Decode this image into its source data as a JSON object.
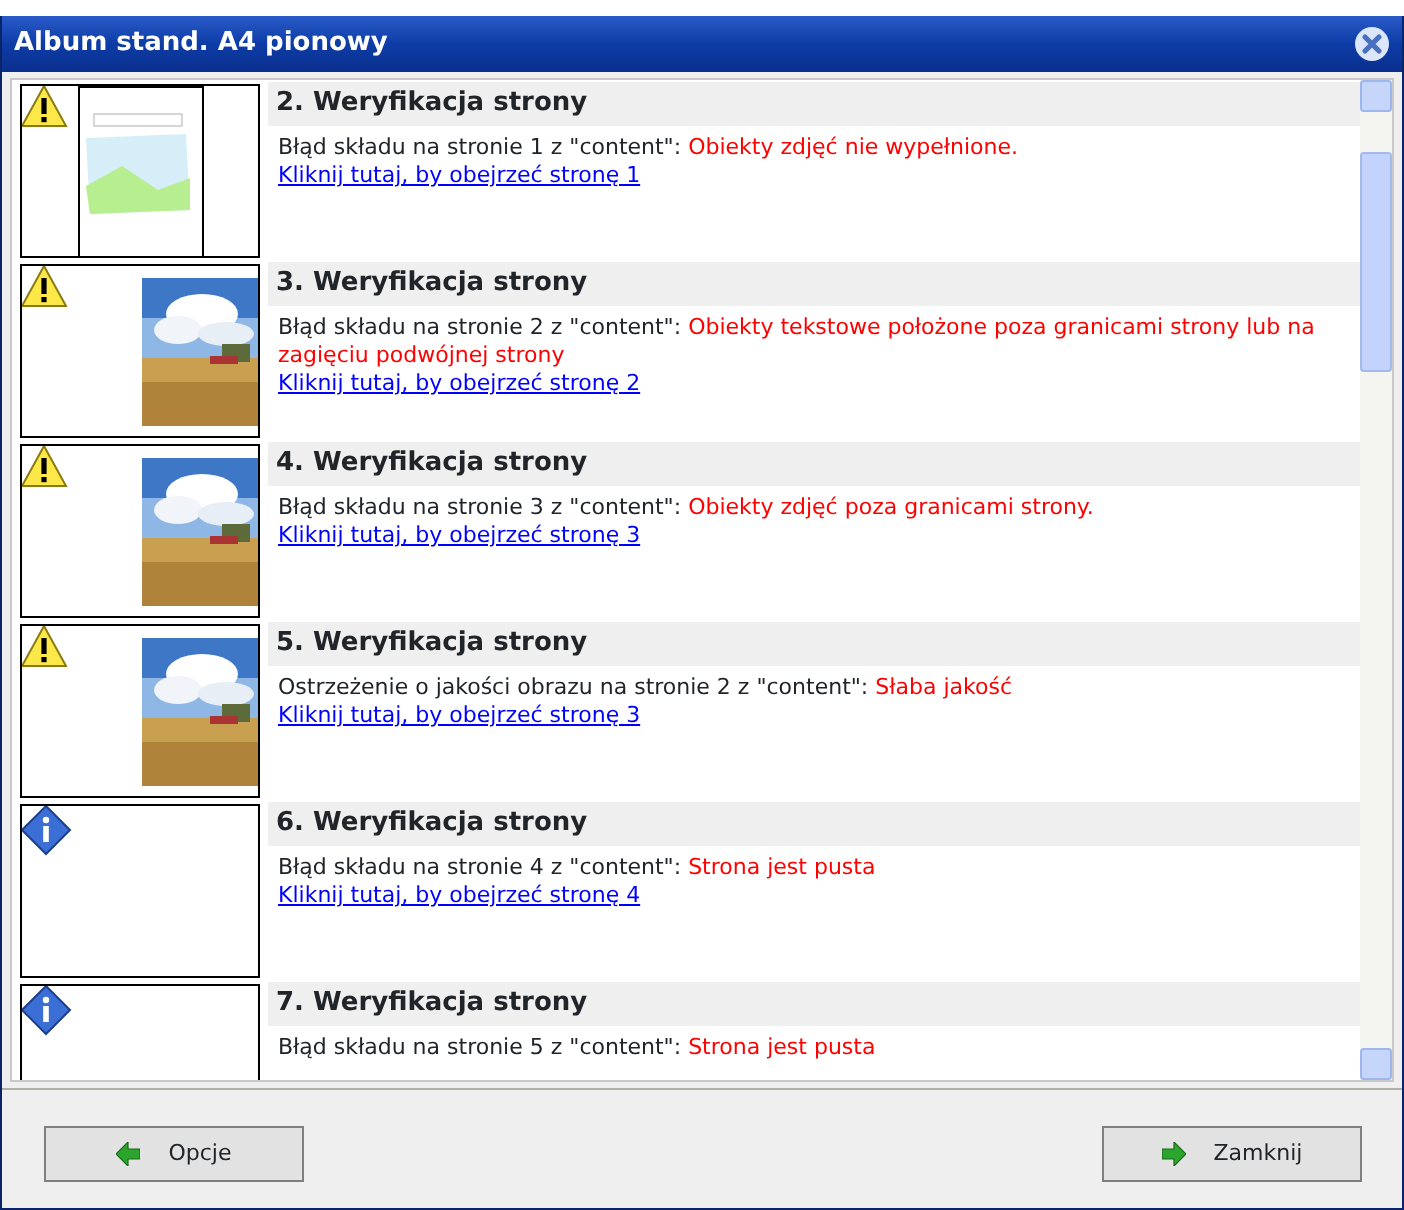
{
  "window": {
    "title": "Album stand. A4 pionowy"
  },
  "items": [
    {
      "kind": "warning",
      "thumbnail": {
        "kind": "layout"
      },
      "title": "2. Weryfikacja strony",
      "message": "Błąd składu na stronie 1 z \"content\": ",
      "problem": "Obiekty zdjęć nie wypełnione.",
      "link": "Kliknij tutaj, by obejrzeć stronę 1"
    },
    {
      "kind": "warning",
      "title": "3. Weryfikacja strony",
      "message": "Błąd składu na stronie 2 z \"content\": ",
      "problem": "Obiekty tekstowe położone poza granicami strony lub na zagięciu podwójnej strony",
      "link": "Kliknij tutaj, by obejrzeć stronę 2"
    },
    {
      "kind": "warning",
      "title": "4. Weryfikacja strony",
      "message": "Błąd składu na stronie 3 z \"content\": ",
      "problem": "Obiekty zdjęć poza granicami strony.",
      "link": "Kliknij tutaj, by obejrzeć stronę 3"
    },
    {
      "kind": "warning",
      "title": "5. Weryfikacja strony",
      "message": "Ostrzeżenie o jakości obrazu na stronie 2 z \"content\": ",
      "problem": "Słaba jakość",
      "link": "Kliknij tutaj, by obejrzeć stronę 3"
    },
    {
      "kind": "info",
      "title": "6. Weryfikacja strony",
      "message": "Błąd składu na stronie 4 z \"content\": ",
      "problem": "Strona jest pusta",
      "link": "Kliknij tutaj, by obejrzeć stronę 4"
    },
    {
      "kind": "info",
      "title": "7. Weryfikacja strony",
      "message": "Błąd składu na stronie 5 z \"content\": ",
      "problem": "Strona jest pusta"
    }
  ],
  "buttons": [
    {
      "label": "Opcje"
    },
    {
      "label": "Zamknij"
    }
  ]
}
